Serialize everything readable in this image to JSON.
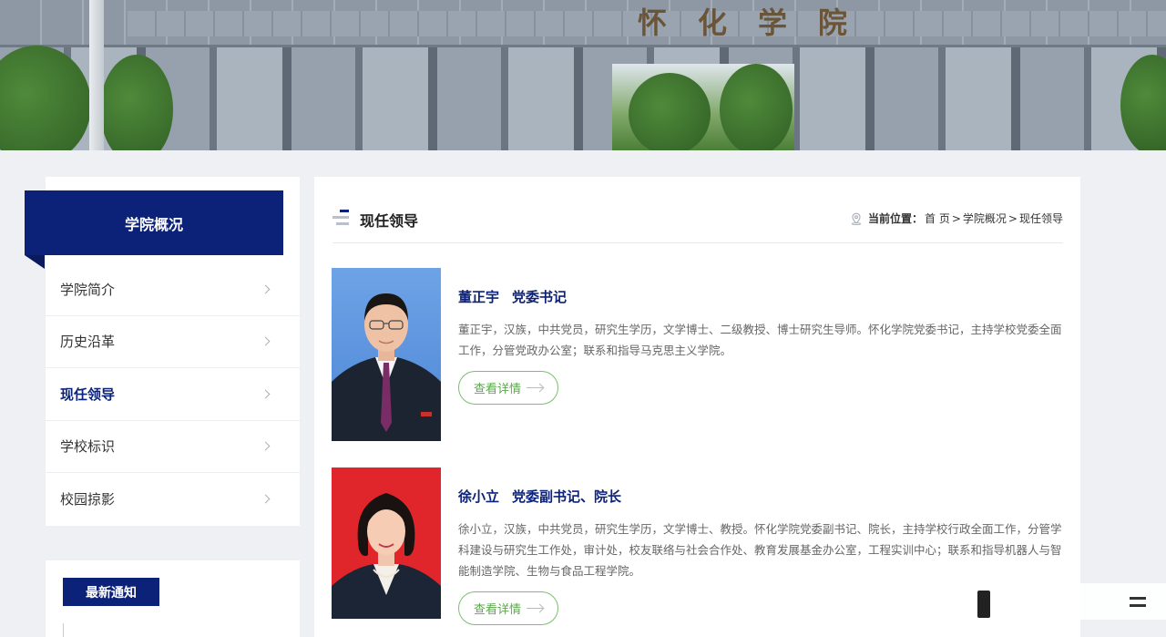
{
  "banner": {
    "gate_text": "怀化学院"
  },
  "sidebar": {
    "title": "学院概况",
    "items": [
      {
        "label": "学院简介",
        "active": false
      },
      {
        "label": "历史沿革",
        "active": false
      },
      {
        "label": "现任领导",
        "active": true
      },
      {
        "label": "学校标识",
        "active": false
      },
      {
        "label": "校园掠影",
        "active": false
      }
    ],
    "notice_title": "最新通知"
  },
  "main": {
    "title": "现任领导",
    "breadcrumb": {
      "label": "当前位置：",
      "items": [
        "首 页",
        "学院概况",
        "现任领导"
      ],
      "separator": ">"
    },
    "leaders": [
      {
        "name": "董正宇",
        "position": "党委书记",
        "description": "董正宇，汉族，中共党员，研究生学历，文学博士、二级教授、博士研究生导师。怀化学院党委书记，主持学校党委全面工作，分管党政办公室；联系和指导马克思主义学院。",
        "button": "查看详情",
        "photo_bg": "#5a92dd"
      },
      {
        "name": "徐小立",
        "position": "党委副书记、院长",
        "description": "徐小立，汉族，中共党员，研究生学历，文学博士、教授。怀化学院党委副书记、院长，主持学校行政全面工作，分管学科建设与研究生工作处，审计处，校友联络与社会合作处、教育发展基金办公室，工程实训中心；联系和指导机器人与智能制造学院、生物与食品工程学院。",
        "button": "查看详情",
        "photo_bg": "#e0262b"
      }
    ]
  },
  "colors": {
    "primary": "#0c2278",
    "accent_green": "#5aa84b"
  }
}
